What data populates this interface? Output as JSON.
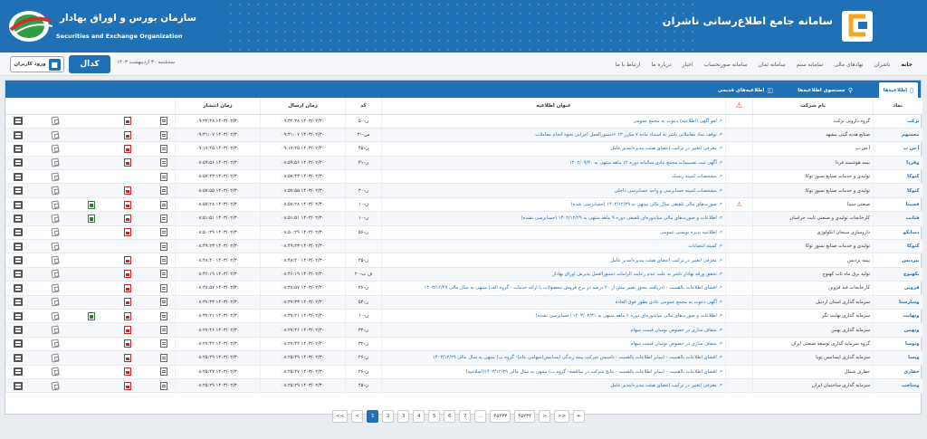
{
  "header": {
    "system_title": "سامانه جامع اطلاع‌رسانی ناشران",
    "org_name_fa": "سازمان بورس و اوراق بهادار",
    "org_name_en": "Securities and Exchange Organization",
    "brand_color": "#1f70b5"
  },
  "nav": {
    "items": [
      "خانه",
      "ناشران",
      "نهادهای مالی",
      "سامانه سنم",
      "سامانه ثمان",
      "سامانه صورتحساب",
      "اخبار",
      "درباره ما",
      "ارتباط با ما"
    ],
    "active_index": 0
  },
  "login": {
    "label": "ورود کاربران"
  },
  "codal_small_label": "کدال",
  "date_text": "سه‌شنبه ۳۰ اردیبهشت ۱۴۰۳",
  "tabs": [
    {
      "label": "اطلاعیه‌ها",
      "icon": "document-icon"
    },
    {
      "label": "جستجوی اطلاعیه‌ها",
      "icon": "search-icon"
    },
    {
      "label": "اطلاعیه‌های قدیمی",
      "icon": "archive-icon"
    }
  ],
  "table": {
    "headers": {
      "symbol": "نماد",
      "company": "نام شرکت",
      "warning": "⚠",
      "title": "عنوان اطلاعیه",
      "code": "کد",
      "sent": "زمان ارسال",
      "published": "زمان انتشار"
    },
    "rows": [
      {
        "symbol": "برکت",
        "company": "گروه دارویی برکت",
        "warn": "",
        "title": "لغو آگهی (اطلاعیه) دعوت به مجمع عمومی",
        "code": "ن-۵۰",
        "sent": "۱۴۰۳/۰۲/۳۰ ۰۹:۳۲:۳۸",
        "published": "۱۴۰۳/۰۲/۳۰ ۰۹:۳۲:۳۸",
        "pdf": true,
        "xls": false
      },
      {
        "symbol": "محشهم",
        "company": "صنایع هدیه گیتی مشهد",
        "warn": "",
        "title": "توقف نماد معاملاتی ناشر به استناد ماده ۷ مکرر ۱۳ «دستورالعمل اجرایی نحوه انجام معاملات",
        "code": "س-۳۰",
        "sent": "۱۴۰۳/۰۲/۳۰ ۰۹:۳۱:۰۷",
        "published": "۱۴۰۳/۰۲/۳۰ ۰۹:۳۱:۰۷",
        "pdf": true,
        "xls": false
      },
      {
        "symbol": "آ س پ",
        "company": "آ.س.پ",
        "warn": "",
        "title": "معرفی /تغییر در ترکیب اعضای هیئت مدیره/مدیر عامل",
        "code": "ن-۴۵",
        "sent": "۱۴۰۳/۰۲/۳۰ ۰۹:۱۷:۲۵",
        "published": "۱۴۰۳/۰۲/۳۰ ۰۹:۱۷:۲۵",
        "pdf": true,
        "xls": false
      },
      {
        "symbol": "وفردا",
        "company": "بیمه هوشمند فردا",
        "warn": "",
        "title": "آگهی ثبت تصمیمات مجمع عادی سالیانه دوره ۱۲ ماهه منتهی به ۱۴۰۲/۰۹/۳۰",
        "code": "ن-۴۱",
        "sent": "۱۴۰۳/۰۲/۳۰ ۰۸:۵۹:۵۶",
        "published": "۱۴۰۳/۰۲/۳۰ ۰۸:۵۹:۵۶",
        "pdf": true,
        "xls": false
      },
      {
        "symbol": "کتوکا",
        "company": "تولیدی و خدمات صنایع نسوز توکا",
        "warn": "",
        "title": "مشخصات کمیته ریسک",
        "code": "",
        "sent": "۱۴۰۳/۰۲/۳۰ ۰۸:۵۷:۴۳",
        "published": "۱۴۰۳/۰۲/۳۰ ۰۸:۵۷:۴۳",
        "pdf": false,
        "xls": false
      },
      {
        "symbol": "کتوکا",
        "company": "تولیدی و خدمات صنایع نسوز توکا",
        "warn": "",
        "title": "مشخصات کمیته حسابرسی و واحد حسابرسی داخلی",
        "code": "ن-۳۰",
        "sent": "۱۴۰۳/۰۲/۳۰ ۰۸:۵۷:۵۵",
        "published": "۱۴۰۳/۰۲/۳۰ ۰۸:۵۷:۵۵",
        "pdf": true,
        "xls": false
      },
      {
        "symbol": "فسینا",
        "company": "صنعتی سینا",
        "warn": "⚠",
        "title": "صورت‌های مالی تلفیقی سال مالی منتهی به ۱۴۰۲/۱۲/۲۹ (حسابرسی شده)",
        "code": "ن-۱۰",
        "sent": "۱۴۰۳/۰۲/۳۰ ۰۸:۵۷:۲۸",
        "published": "۱۴۰۳/۰۲/۳۰ ۰۸:۵۷:۲۸",
        "pdf": true,
        "xls": true
      },
      {
        "symbol": "فثابت",
        "company": "کارخانجات تولیدی و صنعتی ثابت خراسان",
        "warn": "",
        "title": "اطلاعات و صورت‌های مالی میاندوره‌ای تلفیقی دوره ۹ ماهه منتهی به ۱۴۰۲/۱۲/۲۹ (حسابرسی نشده)",
        "code": "ن-۱۰",
        "sent": "۱۴۰۳/۰۲/۳۰ ۰۸:۵۱:۵۱",
        "published": "۱۴۰۳/۰۲/۳۰ ۰۸:۵۱:۵۱",
        "pdf": true,
        "xls": true
      },
      {
        "symbol": "دسانکو",
        "company": "داروسازی سبحان انکولوژی",
        "warn": "",
        "title": "اطلاعیه پذیره نویسی عمومی",
        "code": "ن-۵۶",
        "sent": "۱۴۰۳/۰۲/۳۰ ۰۸:۵۰:۲۹",
        "published": "۱۴۰۳/۰۲/۳۰ ۰۸:۵۰:۲۹",
        "pdf": true,
        "xls": false
      },
      {
        "symbol": "کتوکا",
        "company": "تولیدی و خدمات صنایع نسوز توکا",
        "warn": "",
        "title": "کمیته انتصابات",
        "code": "",
        "sent": "۱۴۰۳/۰۲/۳۰ ۰۸:۴۹:۲۳",
        "published": "۱۴۰۳/۰۲/۳۰ ۰۸:۴۹:۲۳",
        "pdf": false,
        "xls": false
      },
      {
        "symbol": "بپردیس",
        "company": "بیمه پردیس",
        "warn": "",
        "title": "معرفی /تغییر در ترکیب اعضای هیئت مدیره/مدیر عامل",
        "code": "ن-۴۵",
        "sent": "۱۴۰۳/۰۲/۳۰ ۰۸:۴۸:۴۰",
        "published": "۱۴۰۳/۰۲/۳۰ ۰۸:۴۸:۴۰",
        "pdf": true,
        "xls": false
      },
      {
        "symbol": "بکهنوج",
        "company": "تولید برق ماه تاب کهنوج",
        "warn": "",
        "title": "تحقق ورقه بهادار ناشر به علت عدم رعایت الزامات دستورالعمل پذیرش اوراق بهادار",
        "code": "ف ب-۲۰",
        "sent": "۱۴۰۳/۰۲/۳۰ ۰۸:۴۶:۱۹",
        "published": "۱۴۰۳/۰۲/۳۰ ۰۸:۴۶:۱۹",
        "pdf": true,
        "xls": false
      },
      {
        "symbol": "قزوین",
        "company": "کارخانجات قند قزوین",
        "warn": "",
        "title": "افشای اطلاعات بااهمیت - (دریافت مجوز تغییر بیش از ۲۰ درصد در نرخ فروش محصولات یا ارائه خدمات - گروه الف) منتهی به سال مالی ۱۴۰۳/۱۲/۲۹",
        "code": "ن-۲۶",
        "sent": "۱۴۰۳/۰۲/۳۰ ۰۸:۳۸:۵۷",
        "published": "۱۴۰۳/۰۲/۳۰ ۰۸:۳۸:۵۷",
        "pdf": true,
        "xls": false
      },
      {
        "symbol": "وسارستا",
        "company": "سرمایه گذاری استان اردبیل",
        "warn": "",
        "title": "آگهی دعوت به مجمع عمومی عادی بطور فوق العاده",
        "code": "ن-۵۴",
        "sent": "۱۴۰۳/۰۲/۳۰ ۰۸:۳۷:۳۳",
        "published": "۱۴۰۳/۰۲/۳۰ ۰۸:۳۷:۳۳",
        "pdf": true,
        "xls": false
      },
      {
        "symbol": "ونهایت",
        "company": "سرمایه گذاری نهایت نگر",
        "warn": "",
        "title": "اطلاعات و صورت‌های مالی میاندوره‌ای دوره ۶ ماهه منتهی به ۱۴۰۳/۰۲/۳۱ (حسابرسی نشده)",
        "code": "ن-۱۰",
        "sent": "۱۴۰۳/۰۲/۳۰ ۰۸:۳۷:۲۱",
        "published": "۱۴۰۳/۰۲/۳۰ ۰۸:۳۷:۲۱",
        "pdf": true,
        "xls": true
      },
      {
        "symbol": "وبهمن",
        "company": "سرمایه گذاری بهمن",
        "warn": "",
        "title": "شفاف سازی در خصوص نوسان قیمت سهام",
        "code": "ن-۳۲",
        "sent": "۱۴۰۳/۰۲/۳۰ ۰۸:۲۷:۴۶",
        "published": "۱۴۰۳/۰۲/۳۰ ۰۸:۲۷:۴۶",
        "pdf": true,
        "xls": false
      },
      {
        "symbol": "وتوسا",
        "company": "گروه سرمایه گذاری توسعه صنعتی ایران",
        "warn": "",
        "title": "شفاف سازی در خصوص نوسان قیمت سهام",
        "code": "ن-۳۲",
        "sent": "۱۴۰۳/۰۲/۳۰ ۰۸:۲۷:۴۲",
        "published": "۱۴۰۳/۰۲/۳۰ ۰۸:۲۷:۴۲",
        "pdf": true,
        "xls": false
      },
      {
        "symbol": "ویسا",
        "company": "سرمایه گذاری ایساتیس پویا",
        "warn": "",
        "title": "افشای اطلاعات بااهمیت - (سایر اطلاعات بااهمیت - تاسیس شرکت بیمه زندگی ایساتیس(سهامی عام)- گروه ب) منتهی به سال مالی ۱۴۰۳/۱۲/۲۹",
        "code": "ن-۲۶",
        "sent": "۱۴۰۳/۰۲/۳۰ ۰۸:۲۵:۴۹",
        "published": "۱۴۰۳/۰۲/۳۰ ۰۸:۲۵:۴۹",
        "pdf": true,
        "xls": false
      },
      {
        "symbol": "حفاری",
        "company": "حفاری شمال",
        "warn": "",
        "title": "افشای اطلاعات بااهمیت - (سایر اطلاعات بااهمیت - نتایج شرکت در مناقصه- گروه ب) منتهی به سال مالی ۱۴۰۳/۱۲/۲۹(اصلاحیه)",
        "code": "ن-۲۶",
        "sent": "۱۴۰۳/۰۲/۳۰ ۰۸:۲۵:۴۷",
        "published": "۱۴۰۳/۰۲/۳۰ ۰۸:۲۵:۴۷",
        "pdf": true,
        "xls": false
      },
      {
        "symbol": "وساخت",
        "company": "سرمایه گذاری ساختمان ایران",
        "warn": "",
        "title": "معرفی /تغییر در ترکیب اعضای هیئت مدیره/مدیر عامل",
        "code": "ن-۴۵",
        "sent": "۱۴۰۳/۰۲/۳۰ ۰۸:۲۵:۲۹",
        "published": "۱۴۰۳/۰۲/۳۰ ۰۸:۲۵:۲۹",
        "pdf": true,
        "xls": false
      }
    ]
  },
  "pager": {
    "items": [
      "<<",
      "<",
      "1",
      "2",
      "3",
      "4",
      "5",
      "6",
      "7",
      "...",
      "۴۵۲۳۳",
      "۴۵۲۳۴",
      ">",
      ">>",
      "⇤"
    ],
    "active": "1"
  }
}
